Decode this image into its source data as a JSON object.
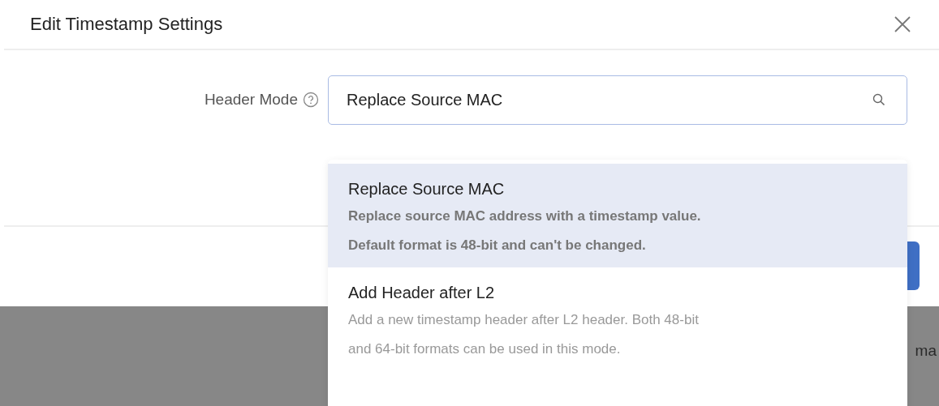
{
  "dialog": {
    "title": "Edit Timestamp Settings"
  },
  "form": {
    "label": "Header Mode",
    "value": "Replace Source MAC"
  },
  "dropdown": {
    "options": [
      {
        "title": "Replace Source MAC",
        "description_lines": [
          "Replace source MAC address with a timestamp value.",
          "Default format is 48-bit and can't be changed."
        ],
        "selected": true
      },
      {
        "title": "Add Header after L2",
        "description_lines": [
          "Add a new timestamp header after L2 header. Both 48-bit",
          "and 64-bit formats can be used in this mode."
        ],
        "selected": false
      }
    ]
  },
  "background_text": "ma"
}
